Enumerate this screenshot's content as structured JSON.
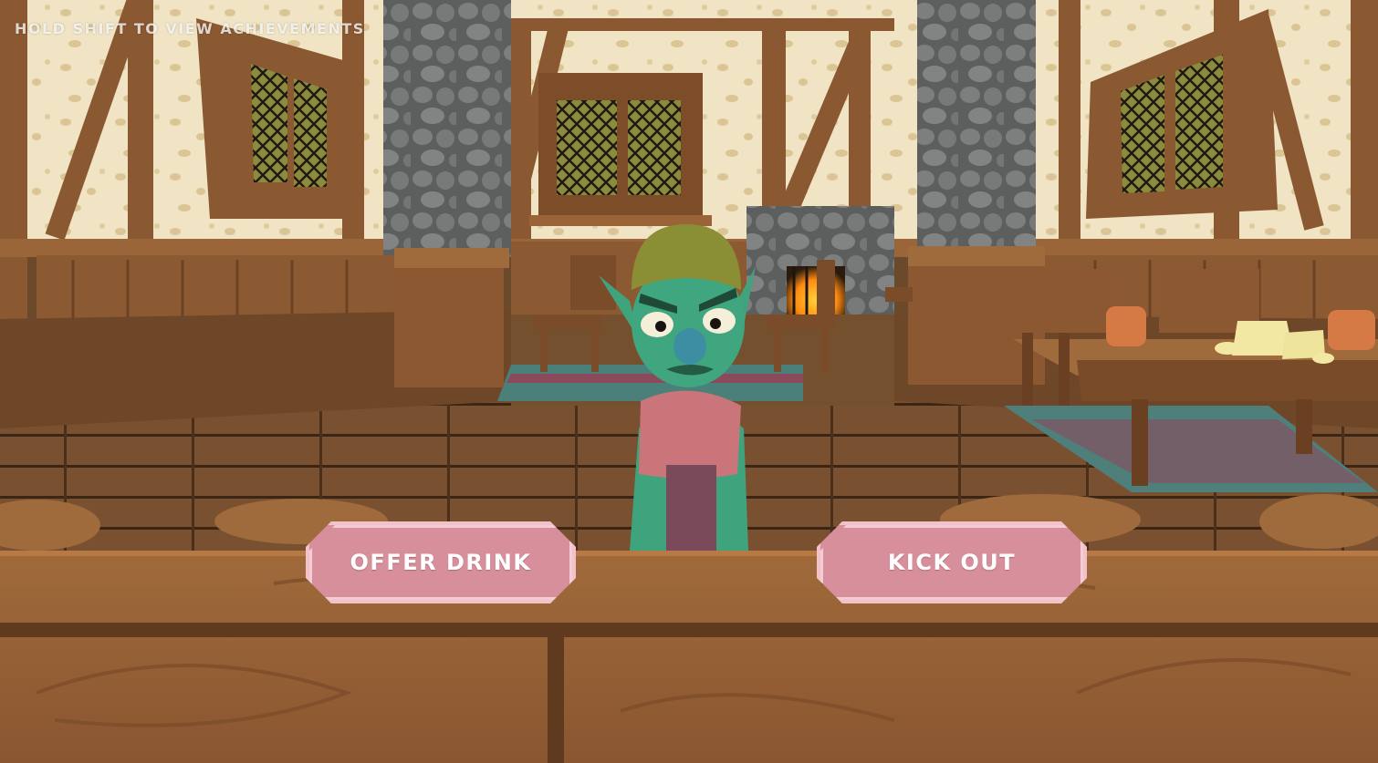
{
  "hud": {
    "hint": "Hold shift to view achievements"
  },
  "dialogue": {
    "offer_label": "Offer drink",
    "kick_label": "Kick out"
  },
  "scene": {
    "character": "goblin-patron",
    "mood": "angry"
  },
  "colors": {
    "button_fill": "#d68f9b",
    "button_border": "#f1c2ca",
    "goblin_skin": "#3fa37d",
    "wall": "#efe2c3",
    "wood": "#8a5a33"
  }
}
